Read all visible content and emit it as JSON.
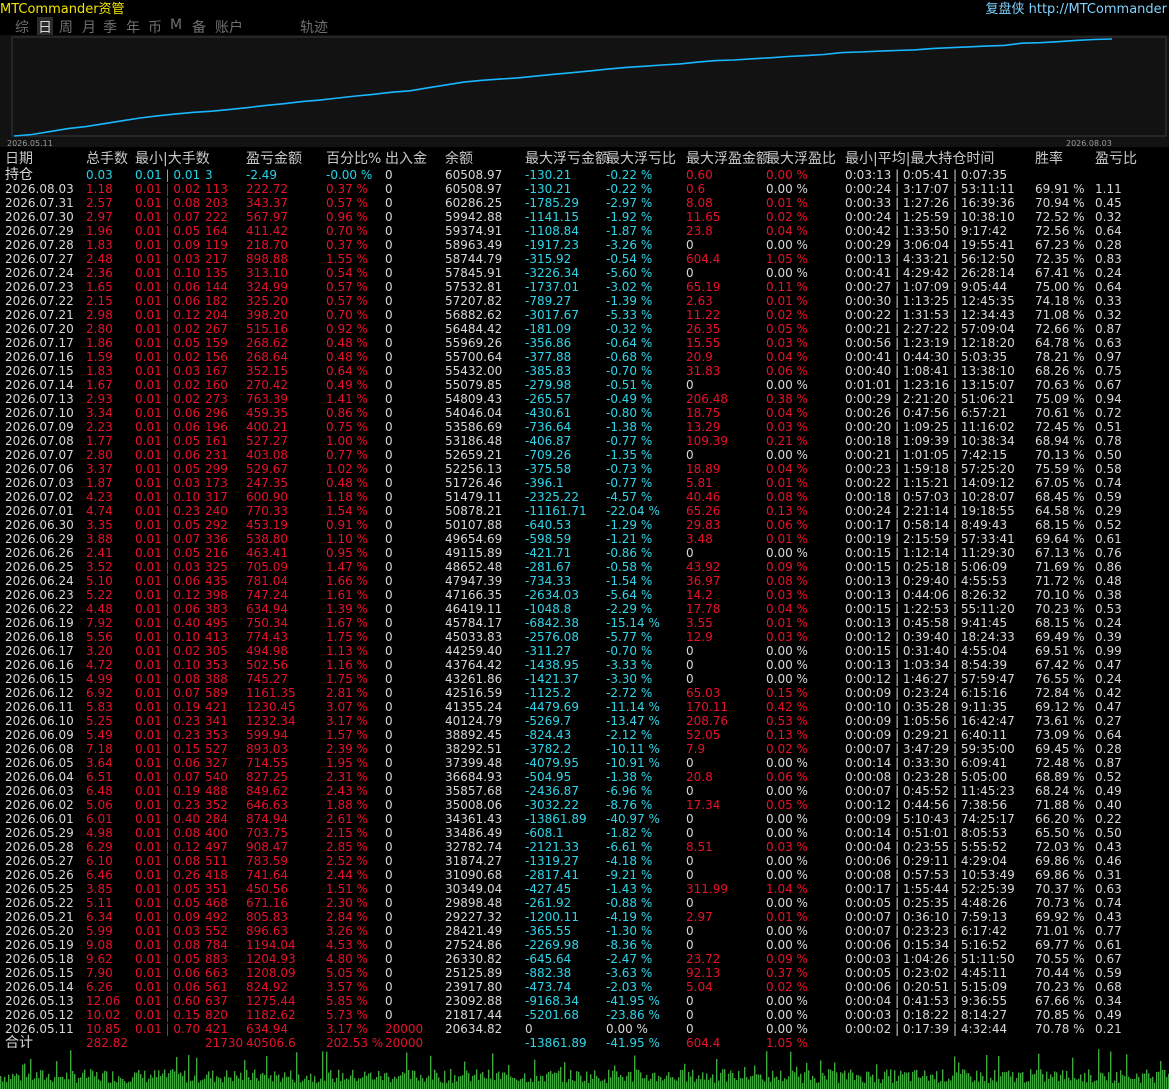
{
  "app_title": "MTCommander资管",
  "top_right": "复盘侠 http://MTCommander",
  "tabs": [
    "综",
    "日",
    "周",
    "月",
    "季",
    "年",
    "币",
    "M",
    "备",
    "账户",
    "轨迹"
  ],
  "active_tab": 1,
  "chart": {
    "start_date": "2026.05.11",
    "end_date": "2026.08.03",
    "line_color": "#19b7ff"
  },
  "header": [
    "日期",
    "总手数",
    "最小|大手数",
    "盈亏金额",
    "百分比%",
    "出入金",
    "余额",
    "最大浮亏金额",
    "最大浮亏比",
    "最大浮盈金额",
    "最大浮盈比",
    "最小|平均|最大持仓时间",
    "胜率",
    "盈亏比"
  ],
  "holding_row": {
    "label": "持仓",
    "lots": "0.03",
    "minmax": "0.01 | 0.01",
    "count": "3",
    "pnl": "-2.49",
    "pct": "-0.00 %",
    "io": "0",
    "balance": "60508.97",
    "mfa": "-130.21",
    "mfp": "-0.22 %",
    "mpa": "0.60",
    "mpp": "0.00 %",
    "time": "0:03:13 | 0:05:41 | 0:07:35"
  },
  "rows": [
    [
      "2026.08.03",
      "1.18",
      "0.01 | 0.02",
      "113",
      "222.72",
      "0.37 %",
      "0",
      "60508.97",
      "-130.21",
      "-0.22 %",
      "0.6",
      "0.00 %",
      "0:00:24 | 3:17:07 | 53:11:11",
      "69.91 %",
      "1.11"
    ],
    [
      "2026.07.31",
      "2.57",
      "0.01 | 0.08",
      "203",
      "343.37",
      "0.57 %",
      "0",
      "60286.25",
      "-1785.29",
      "-2.97 %",
      "8.08",
      "0.01 %",
      "0:00:33 | 1:27:26 | 16:39:36",
      "70.94 %",
      "0.45"
    ],
    [
      "2026.07.30",
      "2.97",
      "0.01 | 0.07",
      "222",
      "567.97",
      "0.96 %",
      "0",
      "59942.88",
      "-1141.15",
      "-1.92 %",
      "11.65",
      "0.02 %",
      "0:00:24 | 1:25:59 | 10:38:10",
      "72.52 %",
      "0.32"
    ],
    [
      "2026.07.29",
      "1.96",
      "0.01 | 0.05",
      "164",
      "411.42",
      "0.70 %",
      "0",
      "59374.91",
      "-1108.84",
      "-1.87 %",
      "23.8",
      "0.04 %",
      "0:00:42 | 1:33:50 | 9:17:42",
      "72.56 %",
      "0.64"
    ],
    [
      "2026.07.28",
      "1.83",
      "0.01 | 0.09",
      "119",
      "218.70",
      "0.37 %",
      "0",
      "58963.49",
      "-1917.23",
      "-3.26 %",
      "0",
      "0.00 %",
      "0:00:29 | 3:06:04 | 19:55:41",
      "67.23 %",
      "0.28"
    ],
    [
      "2026.07.27",
      "2.48",
      "0.01 | 0.03",
      "217",
      "898.88",
      "1.55 %",
      "0",
      "58744.79",
      "-315.92",
      "-0.54 %",
      "604.4",
      "1.05 %",
      "0:00:13 | 4:33:21 | 56:12:50",
      "72.35 %",
      "0.83"
    ],
    [
      "2026.07.24",
      "2.36",
      "0.01 | 0.10",
      "135",
      "313.10",
      "0.54 %",
      "0",
      "57845.91",
      "-3226.34",
      "-5.60 %",
      "0",
      "0.00 %",
      "0:00:41 | 4:29:42 | 26:28:14",
      "67.41 %",
      "0.24"
    ],
    [
      "2026.07.23",
      "1.65",
      "0.01 | 0.06",
      "144",
      "324.99",
      "0.57 %",
      "0",
      "57532.81",
      "-1737.01",
      "-3.02 %",
      "65.19",
      "0.11 %",
      "0:00:27 | 1:07:09 | 9:05:44",
      "75.00 %",
      "0.64"
    ],
    [
      "2026.07.22",
      "2.15",
      "0.01 | 0.06",
      "182",
      "325.20",
      "0.57 %",
      "0",
      "57207.82",
      "-789.27",
      "-1.39 %",
      "2.63",
      "0.01 %",
      "0:00:30 | 1:13:25 | 12:45:35",
      "74.18 %",
      "0.33"
    ],
    [
      "2026.07.21",
      "2.98",
      "0.01 | 0.12",
      "204",
      "398.20",
      "0.70 %",
      "0",
      "56882.62",
      "-3017.67",
      "-5.33 %",
      "11.22",
      "0.02 %",
      "0:00:22 | 1:31:53 | 12:34:43",
      "71.08 %",
      "0.32"
    ],
    [
      "2026.07.20",
      "2.80",
      "0.01 | 0.02",
      "267",
      "515.16",
      "0.92 %",
      "0",
      "56484.42",
      "-181.09",
      "-0.32 %",
      "26.35",
      "0.05 %",
      "0:00:21 | 2:27:22 | 57:09:04",
      "72.66 %",
      "0.87"
    ],
    [
      "2026.07.17",
      "1.86",
      "0.01 | 0.05",
      "159",
      "268.62",
      "0.48 %",
      "0",
      "55969.26",
      "-356.86",
      "-0.64 %",
      "15.55",
      "0.03 %",
      "0:00:56 | 1:23:19 | 12:18:20",
      "64.78 %",
      "0.63"
    ],
    [
      "2026.07.16",
      "1.59",
      "0.01 | 0.02",
      "156",
      "268.64",
      "0.48 %",
      "0",
      "55700.64",
      "-377.88",
      "-0.68 %",
      "20.9",
      "0.04 %",
      "0:00:41 | 0:44:30 | 5:03:35",
      "78.21 %",
      "0.97"
    ],
    [
      "2026.07.15",
      "1.83",
      "0.01 | 0.03",
      "167",
      "352.15",
      "0.64 %",
      "0",
      "55432.00",
      "-385.83",
      "-0.70 %",
      "31.83",
      "0.06 %",
      "0:00:40 | 1:08:41 | 13:38:10",
      "68.26 %",
      "0.75"
    ],
    [
      "2026.07.14",
      "1.67",
      "0.01 | 0.02",
      "160",
      "270.42",
      "0.49 %",
      "0",
      "55079.85",
      "-279.98",
      "-0.51 %",
      "0",
      "0.00 %",
      "0:01:01 | 1:23:16 | 13:15:07",
      "70.63 %",
      "0.67"
    ],
    [
      "2026.07.13",
      "2.93",
      "0.01 | 0.02",
      "273",
      "763.39",
      "1.41 %",
      "0",
      "54809.43",
      "-265.57",
      "-0.49 %",
      "206.48",
      "0.38 %",
      "0:00:29 | 2:21:20 | 51:06:21",
      "75.09 %",
      "0.94"
    ],
    [
      "2026.07.10",
      "3.34",
      "0.01 | 0.06",
      "296",
      "459.35",
      "0.86 %",
      "0",
      "54046.04",
      "-430.61",
      "-0.80 %",
      "18.75",
      "0.04 %",
      "0:00:26 | 0:47:56 | 6:57:21",
      "70.61 %",
      "0.72"
    ],
    [
      "2026.07.09",
      "2.23",
      "0.01 | 0.06",
      "196",
      "400.21",
      "0.75 %",
      "0",
      "53586.69",
      "-736.64",
      "-1.38 %",
      "13.29",
      "0.03 %",
      "0:00:20 | 1:09:25 | 11:16:02",
      "72.45 %",
      "0.51"
    ],
    [
      "2026.07.08",
      "1.77",
      "0.01 | 0.05",
      "161",
      "527.27",
      "1.00 %",
      "0",
      "53186.48",
      "-406.87",
      "-0.77 %",
      "109.39",
      "0.21 %",
      "0:00:18 | 1:09:39 | 10:38:34",
      "68.94 %",
      "0.78"
    ],
    [
      "2026.07.07",
      "2.80",
      "0.01 | 0.06",
      "231",
      "403.08",
      "0.77 %",
      "0",
      "52659.21",
      "-709.26",
      "-1.35 %",
      "0",
      "0.00 %",
      "0:00:21 | 1:01:05 | 7:42:15",
      "70.13 %",
      "0.50"
    ],
    [
      "2026.07.06",
      "3.37",
      "0.01 | 0.05",
      "299",
      "529.67",
      "1.02 %",
      "0",
      "52256.13",
      "-375.58",
      "-0.73 %",
      "18.89",
      "0.04 %",
      "0:00:23 | 1:59:18 | 57:25:20",
      "75.59 %",
      "0.58"
    ],
    [
      "2026.07.03",
      "1.87",
      "0.01 | 0.03",
      "173",
      "247.35",
      "0.48 %",
      "0",
      "51726.46",
      "-396.1",
      "-0.77 %",
      "5.81",
      "0.01 %",
      "0:00:22 | 1:15:21 | 14:09:12",
      "67.05 %",
      "0.74"
    ],
    [
      "2026.07.02",
      "4.23",
      "0.01 | 0.10",
      "317",
      "600.90",
      "1.18 %",
      "0",
      "51479.11",
      "-2325.22",
      "-4.57 %",
      "40.46",
      "0.08 %",
      "0:00:18 | 0:57:03 | 10:28:07",
      "68.45 %",
      "0.59"
    ],
    [
      "2026.07.01",
      "4.74",
      "0.01 | 0.23",
      "240",
      "770.33",
      "1.54 %",
      "0",
      "50878.21",
      "-11161.71",
      "-22.04 %",
      "65.26",
      "0.13 %",
      "0:00:24 | 2:21:14 | 19:18:55",
      "64.58 %",
      "0.29"
    ],
    [
      "2026.06.30",
      "3.35",
      "0.01 | 0.05",
      "292",
      "453.19",
      "0.91 %",
      "0",
      "50107.88",
      "-640.53",
      "-1.29 %",
      "29.83",
      "0.06 %",
      "0:00:17 | 0:58:14 | 8:49:43",
      "68.15 %",
      "0.52"
    ],
    [
      "2026.06.29",
      "3.88",
      "0.01 | 0.07",
      "336",
      "538.80",
      "1.10 %",
      "0",
      "49654.69",
      "-598.59",
      "-1.21 %",
      "3.48",
      "0.01 %",
      "0:00:19 | 2:15:59 | 57:33:41",
      "69.64 %",
      "0.61"
    ],
    [
      "2026.06.26",
      "2.41",
      "0.01 | 0.05",
      "216",
      "463.41",
      "0.95 %",
      "0",
      "49115.89",
      "-421.71",
      "-0.86 %",
      "0",
      "0.00 %",
      "0:00:15 | 1:12:14 | 11:29:30",
      "67.13 %",
      "0.76"
    ],
    [
      "2026.06.25",
      "3.52",
      "0.01 | 0.03",
      "325",
      "705.09",
      "1.47 %",
      "0",
      "48652.48",
      "-281.67",
      "-0.58 %",
      "43.92",
      "0.09 %",
      "0:00:15 | 0:25:18 | 5:06:09",
      "71.69 %",
      "0.86"
    ],
    [
      "2026.06.24",
      "5.10",
      "0.01 | 0.06",
      "435",
      "781.04",
      "1.66 %",
      "0",
      "47947.39",
      "-734.33",
      "-1.54 %",
      "36.97",
      "0.08 %",
      "0:00:13 | 0:29:40 | 4:55:53",
      "71.72 %",
      "0.48"
    ],
    [
      "2026.06.23",
      "5.22",
      "0.01 | 0.12",
      "398",
      "747.24",
      "1.61 %",
      "0",
      "47166.35",
      "-2634.03",
      "-5.64 %",
      "14.2",
      "0.03 %",
      "0:00:13 | 0:44:06 | 8:26:32",
      "70.10 %",
      "0.38"
    ],
    [
      "2026.06.22",
      "4.48",
      "0.01 | 0.06",
      "383",
      "634.94",
      "1.39 %",
      "0",
      "46419.11",
      "-1048.8",
      "-2.29 %",
      "17.78",
      "0.04 %",
      "0:00:15 | 1:22:53 | 55:11:20",
      "70.23 %",
      "0.53"
    ],
    [
      "2026.06.19",
      "7.92",
      "0.01 | 0.40",
      "495",
      "750.34",
      "1.67 %",
      "0",
      "45784.17",
      "-6842.38",
      "-15.14 %",
      "3.55",
      "0.01 %",
      "0:00:13 | 0:45:58 | 9:41:45",
      "68.15 %",
      "0.24"
    ],
    [
      "2026.06.18",
      "5.56",
      "0.01 | 0.10",
      "413",
      "774.43",
      "1.75 %",
      "0",
      "45033.83",
      "-2576.08",
      "-5.77 %",
      "12.9",
      "0.03 %",
      "0:00:12 | 0:39:40 | 18:24:33",
      "69.49 %",
      "0.39"
    ],
    [
      "2026.06.17",
      "3.20",
      "0.01 | 0.02",
      "305",
      "494.98",
      "1.13 %",
      "0",
      "44259.40",
      "-311.27",
      "-0.70 %",
      "0",
      "0.00 %",
      "0:00:15 | 0:31:40 | 4:55:04",
      "69.51 %",
      "0.99"
    ],
    [
      "2026.06.16",
      "4.72",
      "0.01 | 0.10",
      "353",
      "502.56",
      "1.16 %",
      "0",
      "43764.42",
      "-1438.95",
      "-3.33 %",
      "0",
      "0.00 %",
      "0:00:13 | 1:03:34 | 8:54:39",
      "67.42 %",
      "0.47"
    ],
    [
      "2026.06.15",
      "4.99",
      "0.01 | 0.08",
      "388",
      "745.27",
      "1.75 %",
      "0",
      "43261.86",
      "-1421.37",
      "-3.30 %",
      "0",
      "0.00 %",
      "0:00:12 | 1:46:27 | 57:59:47",
      "76.55 %",
      "0.24"
    ],
    [
      "2026.06.12",
      "6.92",
      "0.01 | 0.07",
      "589",
      "1161.35",
      "2.81 %",
      "0",
      "42516.59",
      "-1125.2",
      "-2.72 %",
      "65.03",
      "0.15 %",
      "0:00:09 | 0:23:24 | 6:15:16",
      "72.84 %",
      "0.42"
    ],
    [
      "2026.06.11",
      "5.83",
      "0.01 | 0.19",
      "421",
      "1230.45",
      "3.07 %",
      "0",
      "41355.24",
      "-4479.69",
      "-11.14 %",
      "170.11",
      "0.42 %",
      "0:00:10 | 0:35:28 | 9:11:35",
      "69.12 %",
      "0.47"
    ],
    [
      "2026.06.10",
      "5.25",
      "0.01 | 0.23",
      "341",
      "1232.34",
      "3.17 %",
      "0",
      "40124.79",
      "-5269.7",
      "-13.47 %",
      "208.76",
      "0.53 %",
      "0:00:09 | 1:05:56 | 16:42:47",
      "73.61 %",
      "0.27"
    ],
    [
      "2026.06.09",
      "5.49",
      "0.01 | 0.23",
      "353",
      "599.94",
      "1.57 %",
      "0",
      "38892.45",
      "-824.43",
      "-2.12 %",
      "52.05",
      "0.13 %",
      "0:00:09 | 0:29:21 | 6:40:11",
      "73.09 %",
      "0.64"
    ],
    [
      "2026.06.08",
      "7.18",
      "0.01 | 0.15",
      "527",
      "893.03",
      "2.39 %",
      "0",
      "38292.51",
      "-3782.2",
      "-10.11 %",
      "7.9",
      "0.02 %",
      "0:00:07 | 3:47:29 | 59:35:00",
      "69.45 %",
      "0.28"
    ],
    [
      "2026.06.05",
      "3.64",
      "0.01 | 0.06",
      "327",
      "714.55",
      "1.95 %",
      "0",
      "37399.48",
      "-4079.95",
      "-10.91 %",
      "0",
      "0.00 %",
      "0:00:14 | 0:33:30 | 6:09:41",
      "72.48 %",
      "0.87"
    ],
    [
      "2026.06.04",
      "6.51",
      "0.01 | 0.07",
      "540",
      "827.25",
      "2.31 %",
      "0",
      "36684.93",
      "-504.95",
      "-1.38 %",
      "20.8",
      "0.06 %",
      "0:00:08 | 0:23:28 | 5:05:00",
      "68.89 %",
      "0.52"
    ],
    [
      "2026.06.03",
      "6.48",
      "0.01 | 0.19",
      "488",
      "849.62",
      "2.43 %",
      "0",
      "35857.68",
      "-2436.87",
      "-6.96 %",
      "0",
      "0.00 %",
      "0:00:07 | 0:45:52 | 11:45:23",
      "68.24 %",
      "0.49"
    ],
    [
      "2026.06.02",
      "5.06",
      "0.01 | 0.23",
      "352",
      "646.63",
      "1.88 %",
      "0",
      "35008.06",
      "-3032.22",
      "-8.76 %",
      "17.34",
      "0.05 %",
      "0:00:12 | 0:44:56 | 7:38:56",
      "71.88 %",
      "0.40"
    ],
    [
      "2026.06.01",
      "6.01",
      "0.01 | 0.40",
      "284",
      "874.94",
      "2.61 %",
      "0",
      "34361.43",
      "-13861.89",
      "-40.97 %",
      "0",
      "0.00 %",
      "0:00:09 | 5:10:43 | 74:25:17",
      "66.20 %",
      "0.22"
    ],
    [
      "2026.05.29",
      "4.98",
      "0.01 | 0.08",
      "400",
      "703.75",
      "2.15 %",
      "0",
      "33486.49",
      "-608.1",
      "-1.82 %",
      "0",
      "0.00 %",
      "0:00:14 | 0:51:01 | 8:05:53",
      "65.50 %",
      "0.50"
    ],
    [
      "2026.05.28",
      "6.29",
      "0.01 | 0.12",
      "497",
      "908.47",
      "2.85 %",
      "0",
      "32782.74",
      "-2121.33",
      "-6.61 %",
      "8.51",
      "0.03 %",
      "0:00:04 | 0:23:55 | 5:55:52",
      "72.03 %",
      "0.43"
    ],
    [
      "2026.05.27",
      "6.10",
      "0.01 | 0.08",
      "511",
      "783.59",
      "2.52 %",
      "0",
      "31874.27",
      "-1319.27",
      "-4.18 %",
      "0",
      "0.00 %",
      "0:00:06 | 0:29:11 | 4:29:04",
      "69.86 %",
      "0.46"
    ],
    [
      "2026.05.26",
      "6.46",
      "0.01 | 0.26",
      "418",
      "741.64",
      "2.44 %",
      "0",
      "31090.68",
      "-2817.41",
      "-9.21 %",
      "0",
      "0.00 %",
      "0:00:08 | 0:57:53 | 10:53:49",
      "69.86 %",
      "0.31"
    ],
    [
      "2026.05.25",
      "3.85",
      "0.01 | 0.05",
      "351",
      "450.56",
      "1.51 %",
      "0",
      "30349.04",
      "-427.45",
      "-1.43 %",
      "311.99",
      "1.04 %",
      "0:00:17 | 1:55:44 | 52:25:39",
      "70.37 %",
      "0.63"
    ],
    [
      "2026.05.22",
      "5.11",
      "0.01 | 0.05",
      "468",
      "671.16",
      "2.30 %",
      "0",
      "29898.48",
      "-261.92",
      "-0.88 %",
      "0",
      "0.00 %",
      "0:00:05 | 0:25:35 | 4:48:26",
      "70.73 %",
      "0.74"
    ],
    [
      "2026.05.21",
      "6.34",
      "0.01 | 0.09",
      "492",
      "805.83",
      "2.84 %",
      "0",
      "29227.32",
      "-1200.11",
      "-4.19 %",
      "2.97",
      "0.01 %",
      "0:00:07 | 0:36:10 | 7:59:13",
      "69.92 %",
      "0.43"
    ],
    [
      "2026.05.20",
      "5.99",
      "0.01 | 0.03",
      "552",
      "896.63",
      "3.26 %",
      "0",
      "28421.49",
      "-365.55",
      "-1.30 %",
      "0",
      "0.00 %",
      "0:00:07 | 0:23:23 | 6:17:42",
      "71.01 %",
      "0.77"
    ],
    [
      "2026.05.19",
      "9.08",
      "0.01 | 0.08",
      "784",
      "1194.04",
      "4.53 %",
      "0",
      "27524.86",
      "-2269.98",
      "-8.36 %",
      "0",
      "0.00 %",
      "0:00:06 | 0:15:34 | 5:16:52",
      "69.77 %",
      "0.61"
    ],
    [
      "2026.05.18",
      "9.62",
      "0.01 | 0.05",
      "883",
      "1204.93",
      "4.80 %",
      "0",
      "26330.82",
      "-645.64",
      "-2.47 %",
      "23.72",
      "0.09 %",
      "0:00:03 | 1:04:26 | 51:11:50",
      "70.55 %",
      "0.67"
    ],
    [
      "2026.05.15",
      "7.90",
      "0.01 | 0.06",
      "663",
      "1208.09",
      "5.05 %",
      "0",
      "25125.89",
      "-882.38",
      "-3.63 %",
      "92.13",
      "0.37 %",
      "0:00:05 | 0:23:02 | 4:45:11",
      "70.44 %",
      "0.59"
    ],
    [
      "2026.05.14",
      "6.26",
      "0.01 | 0.06",
      "561",
      "824.92",
      "3.57 %",
      "0",
      "23917.80",
      "-473.74",
      "-2.03 %",
      "5.04",
      "0.02 %",
      "0:00:06 | 0:20:51 | 5:15:09",
      "70.23 %",
      "0.68"
    ],
    [
      "2026.05.13",
      "12.06",
      "0.01 | 0.60",
      "637",
      "1275.44",
      "5.85 %",
      "0",
      "23092.88",
      "-9168.34",
      "-41.95 %",
      "0",
      "0.00 %",
      "0:00:04 | 0:41:53 | 9:36:55",
      "67.66 %",
      "0.34"
    ],
    [
      "2026.05.12",
      "10.02",
      "0.01 | 0.15",
      "820",
      "1182.62",
      "5.73 %",
      "0",
      "21817.44",
      "-5201.68",
      "-23.86 %",
      "0",
      "0.00 %",
      "0:00:03 | 0:18:22 | 8:14:27",
      "70.85 %",
      "0.49"
    ],
    [
      "2026.05.11",
      "10.85",
      "0.01 | 0.70",
      "421",
      "634.94",
      "3.17 %",
      "20000",
      "20634.82",
      "0",
      "0.00 %",
      "0",
      "0.00 %",
      "0:00:02 | 0:17:39 | 4:32:44",
      "70.78 %",
      "0.21"
    ]
  ],
  "total_row": {
    "label": "合计",
    "lots": "282.82",
    "count": "21730",
    "pnl": "40506.6",
    "pct": "202.53 %",
    "io": "20000",
    "mfa": "-13861.89",
    "mfp": "-41.95 %",
    "mpa": "604.4",
    "mpp": "1.05 %"
  }
}
